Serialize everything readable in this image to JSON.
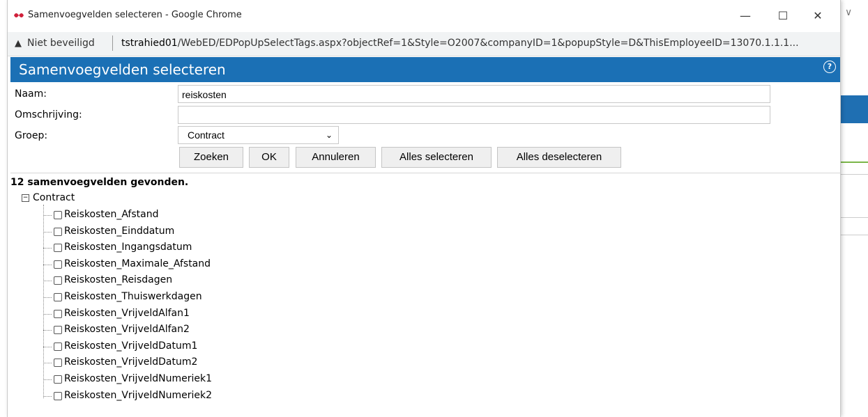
{
  "window": {
    "title": "Samenvoegvelden selecteren - Google Chrome",
    "minimize": "—",
    "maximize": "☐",
    "close": "✕"
  },
  "address": {
    "security": "Niet beveiligd",
    "host": "tstrahied01",
    "path": "/WebED/EDPopUpSelectTags.aspx?objectRef=1&Style=O2007&companyID=1&popupStyle=D&ThisEmployeeID=13070.1.1.1..."
  },
  "dialog": {
    "title": "Samenvoegvelden selecteren",
    "help": "?"
  },
  "form": {
    "name_label": "Naam:",
    "name_value": "reiskosten",
    "desc_label": "Omschrijving:",
    "desc_value": "",
    "group_label": "Groep:",
    "group_value": "Contract"
  },
  "buttons": {
    "search": "Zoeken",
    "ok": "OK",
    "cancel": "Annuleren",
    "select_all": "Alles selecteren",
    "deselect_all": "Alles deselecteren"
  },
  "results": {
    "count_text": "12 samenvoegvelden gevonden.",
    "group_node": "Contract",
    "collapse_symbol": "−",
    "items": [
      "Reiskosten_Afstand",
      "Reiskosten_Einddatum",
      "Reiskosten_Ingangsdatum",
      "Reiskosten_Maximale_Afstand",
      "Reiskosten_Reisdagen",
      "Reiskosten_Thuiswerkdagen",
      "Reiskosten_VrijveldAlfan1",
      "Reiskosten_VrijveldAlfan2",
      "Reiskosten_VrijveldDatum1",
      "Reiskosten_VrijveldDatum2",
      "Reiskosten_VrijveldNumeriek1",
      "Reiskosten_VrijveldNumeriek2"
    ]
  },
  "colors": {
    "header_blue": "#1b70b5",
    "accent_green": "#7ab648"
  }
}
